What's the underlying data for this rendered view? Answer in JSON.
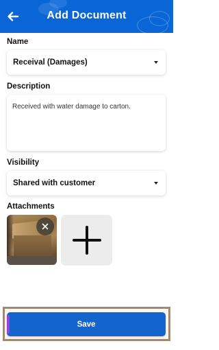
{
  "header": {
    "title": "Add Document",
    "background_color": "#0a66d6",
    "back_icon": "arrow-left-icon"
  },
  "name_field": {
    "label": "Name",
    "value": "Receival (Damages)",
    "icon": "chevron-down-icon"
  },
  "description_field": {
    "label": "Description",
    "value": "Received with water damage to carton."
  },
  "visibility_field": {
    "label": "Visibility",
    "value": "Shared with customer",
    "icon": "chevron-down-icon"
  },
  "attachments": {
    "label": "Attachments",
    "items": [
      {
        "type": "photo",
        "remove_icon": "close-icon"
      }
    ],
    "add_icon": "plus-icon"
  },
  "footer": {
    "save_label": "Save",
    "button_color": "#1364cc"
  }
}
